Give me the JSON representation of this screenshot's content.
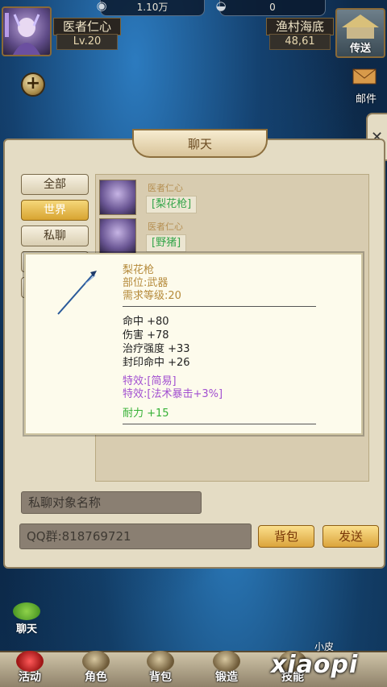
{
  "resources": {
    "gold": "1.10万",
    "silver": "0"
  },
  "player": {
    "name": "医者仁心",
    "level": "Lv.20"
  },
  "location": {
    "name": "渔村海底",
    "coords": "48,61",
    "teleport_label": "传送"
  },
  "mail_label": "邮件",
  "plus_icon": "+",
  "panel": {
    "title": "聊天",
    "tabs": [
      "全部",
      "世界",
      "私聊"
    ],
    "active_tab": "世界",
    "messages": [
      {
        "sender": "医者仁心",
        "item": "[梨花枪]"
      },
      {
        "sender": "医者仁心",
        "item": "[野猪]"
      }
    ],
    "private_target_placeholder": "私聊对象名称",
    "chat_input_value": "QQ群:818769721",
    "bag_button": "背包",
    "send_button": "发送"
  },
  "tooltip": {
    "name": "梨花枪",
    "slot": "部位:武器",
    "requirement": "需求等级:20",
    "stats": [
      "命中 +80",
      "伤害 +78",
      "治疗强度 +33",
      "封印命中 +26"
    ],
    "effects": [
      "特效:[简易]",
      "特效:[法术暴击+3%]"
    ],
    "durability": "耐力 +15"
  },
  "chat_shortcut_label": "聊天",
  "bottom_nav": [
    "活动",
    "角色",
    "背包",
    "锻造",
    "技能"
  ],
  "watermark": {
    "main": "xiaopi",
    "small": "小皮"
  },
  "colors": {
    "title_gold": "#b58a3a",
    "effect_purple": "#a24fd0",
    "durability_green": "#35b035"
  }
}
